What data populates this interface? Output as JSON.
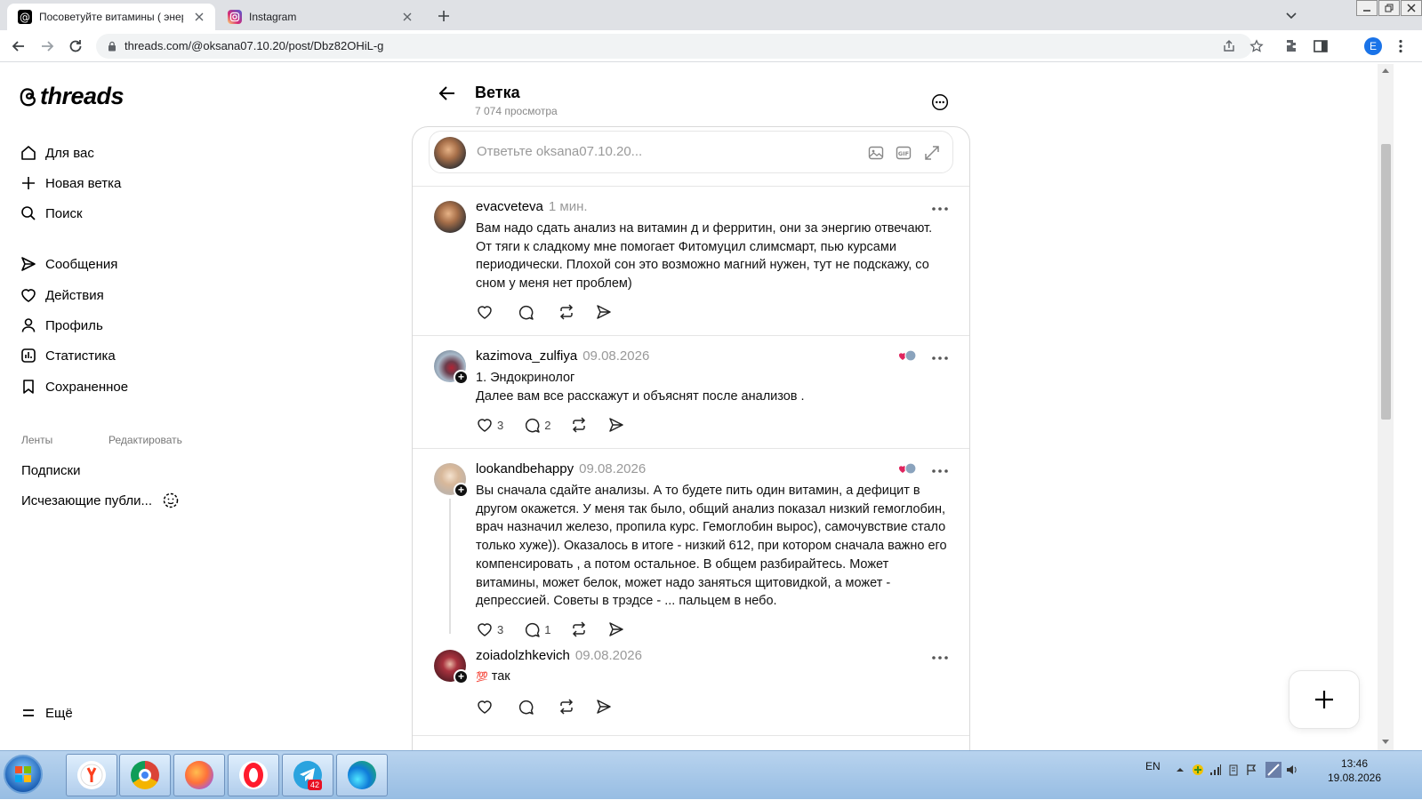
{
  "browser": {
    "tabs": [
      {
        "title": "Посоветуйте витамины ( энергия",
        "active": true,
        "icon": "threads-icon"
      },
      {
        "title": "Instagram",
        "active": false,
        "icon": "instagram-icon"
      }
    ],
    "url": "threads.com/@oksana07.10.20/post/Dbz82OHiL-g",
    "profile_letter": "E"
  },
  "sidebar": {
    "logo_text": "threads",
    "nav": [
      {
        "label": "Для вас",
        "icon": "home-icon"
      },
      {
        "label": "Новая ветка",
        "icon": "plus-icon"
      },
      {
        "label": "Поиск",
        "icon": "search-icon"
      },
      {
        "label": "Сообщения",
        "icon": "send-icon"
      },
      {
        "label": "Действия",
        "icon": "heart-icon"
      },
      {
        "label": "Профиль",
        "icon": "user-icon"
      },
      {
        "label": "Статистика",
        "icon": "stats-icon"
      },
      {
        "label": "Сохраненное",
        "icon": "bookmark-icon"
      }
    ],
    "feeds_label": "Ленты",
    "edit_label": "Редактировать",
    "feeds": [
      {
        "label": "Подписки"
      },
      {
        "label": "Исчезающие публи..."
      }
    ],
    "more_label": "Ещё"
  },
  "thread": {
    "title": "Ветка",
    "views": "7 074 просмотра",
    "composer_placeholder": "Ответьте oksana07.10.20..."
  },
  "posts": [
    {
      "username": "evacveteva",
      "date": "1 мин.",
      "text": "Вам надо сдать анализ на витамин д и ферритин, они за энергию отвечают. От тяги к сладкому мне помогает Фитомуцил слимсмарт, пью курсами периодически. Плохой сон это возможно магний нужен, тут не подскажу, со сном у меня нет проблем)",
      "likes": "",
      "replies": ""
    },
    {
      "username": "kazimova_zulfiya",
      "date": "09.08.2026",
      "text_lines": [
        "1. Эндокринолог",
        "Далее вам все расскажут и объяснят после анализов ."
      ],
      "likes": "3",
      "replies": "2"
    },
    {
      "username": "lookandbehappy",
      "date": "09.08.2026",
      "text": "Вы сначала сдайте анализы. А то будете пить один витамин, а дефицит в другом окажется. У меня так было, общий анализ показал низкий гемоглобин, врач назначил железо, пропила курс. Гемоглобин вырос), самочувствие стало только хуже)). Оказалось в итоге - низкий 612, при котором сначала важно его компенсировать , а потом остальное. В общем разбирайтесь. Может витамины, может белок, может надо заняться щитовидкой, а может - депрессией. Советы в трэдсе - ... пальцем в небо.",
      "likes": "3",
      "replies": "1"
    },
    {
      "username": "zoiadolzhkevich",
      "date": "09.08.2026",
      "emoji": "💯",
      "text": "так",
      "likes": "",
      "replies": ""
    }
  ],
  "taskbar": {
    "lang": "EN",
    "time": "13:46",
    "date": "19.08.2026",
    "telegram_badge": "42"
  }
}
